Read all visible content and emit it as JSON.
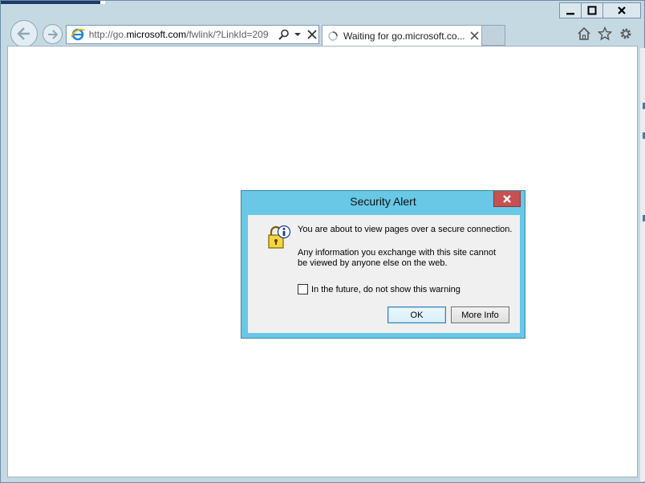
{
  "window": {
    "caption_buttons": [
      "minimize",
      "maximize",
      "close"
    ]
  },
  "navigation": {
    "back_icon": "back-arrow-icon",
    "forward_icon": "forward-arrow-icon"
  },
  "address_bar": {
    "url_prefix": "http://go.",
    "url_domain": "microsoft.com",
    "url_suffix": "/fwlink/?LinkId=209",
    "icons": [
      "search-icon",
      "dropdown-icon",
      "stop-icon"
    ]
  },
  "tabs": [
    {
      "title": "Waiting for go.microsoft.co...",
      "loading": true
    }
  ],
  "toolbar": {
    "icons": [
      "home-icon",
      "favorites-star-icon",
      "gear-icon"
    ]
  },
  "dialog": {
    "title": "Security Alert",
    "message_primary": "You are about to view pages over a secure connection.",
    "message_secondary": "Any information you exchange with this site cannot be viewed by anyone else on the web.",
    "checkbox_label": "In the future, do not show this warning",
    "checkbox_checked": false,
    "ok_label": "OK",
    "more_info_label": "More Info",
    "colors": {
      "frame": "#68c8e6",
      "close": "#c75050"
    }
  }
}
